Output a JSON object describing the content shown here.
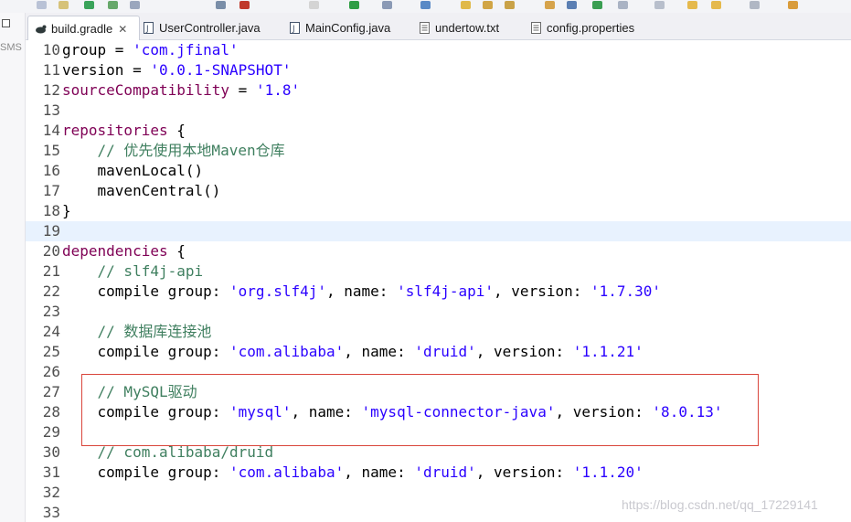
{
  "sidebar": {
    "label": "SMS"
  },
  "tabs": [
    {
      "label": "build.gradle",
      "icon": "gradle-file-icon",
      "active": true,
      "closable": true
    },
    {
      "label": "UserController.java",
      "icon": "java-file-icon",
      "active": false
    },
    {
      "label": "MainConfig.java",
      "icon": "java-file-icon",
      "active": false
    },
    {
      "label": "undertow.txt",
      "icon": "text-file-icon",
      "active": false
    },
    {
      "label": "config.properties",
      "icon": "properties-file-icon",
      "active": false
    }
  ],
  "tab_close_glyph": "✕",
  "editor": {
    "current_line": 19,
    "lines": [
      {
        "n": "10",
        "segs": [
          {
            "t": "group = ",
            "c": "pl"
          },
          {
            "t": "'com.jfinal'",
            "c": "str"
          }
        ]
      },
      {
        "n": "11",
        "segs": [
          {
            "t": "version = ",
            "c": "pl"
          },
          {
            "t": "'0.0.1-SNAPSHOT'",
            "c": "str"
          }
        ]
      },
      {
        "n": "12",
        "segs": [
          {
            "t": "sourceCompatibility",
            "c": "kw"
          },
          {
            "t": " = ",
            "c": "pl"
          },
          {
            "t": "'1.8'",
            "c": "str"
          }
        ]
      },
      {
        "n": "13",
        "segs": []
      },
      {
        "n": "14",
        "segs": [
          {
            "t": "repositories",
            "c": "kw"
          },
          {
            "t": " {",
            "c": "pl"
          }
        ]
      },
      {
        "n": "15",
        "segs": [
          {
            "t": "    ",
            "c": "pl"
          },
          {
            "t": "// 优先使用本地Maven仓库",
            "c": "cm"
          }
        ]
      },
      {
        "n": "16",
        "segs": [
          {
            "t": "    mavenLocal()",
            "c": "pl"
          }
        ]
      },
      {
        "n": "17",
        "segs": [
          {
            "t": "    mavenCentral()",
            "c": "pl"
          }
        ]
      },
      {
        "n": "18",
        "segs": [
          {
            "t": "}",
            "c": "pl"
          }
        ]
      },
      {
        "n": "19",
        "segs": []
      },
      {
        "n": "20",
        "segs": [
          {
            "t": "dependencies",
            "c": "kw"
          },
          {
            "t": " {",
            "c": "pl"
          }
        ]
      },
      {
        "n": "21",
        "segs": [
          {
            "t": "    ",
            "c": "pl"
          },
          {
            "t": "// slf4j-api",
            "c": "cm"
          }
        ]
      },
      {
        "n": "22",
        "segs": [
          {
            "t": "    compile group: ",
            "c": "pl"
          },
          {
            "t": "'org.slf4j'",
            "c": "str"
          },
          {
            "t": ", name: ",
            "c": "pl"
          },
          {
            "t": "'slf4j-api'",
            "c": "str"
          },
          {
            "t": ", version: ",
            "c": "pl"
          },
          {
            "t": "'1.7.30'",
            "c": "str"
          }
        ]
      },
      {
        "n": "23",
        "segs": []
      },
      {
        "n": "24",
        "segs": [
          {
            "t": "    ",
            "c": "pl"
          },
          {
            "t": "// 数据库连接池",
            "c": "cm"
          }
        ]
      },
      {
        "n": "25",
        "segs": [
          {
            "t": "    compile group: ",
            "c": "pl"
          },
          {
            "t": "'com.alibaba'",
            "c": "str"
          },
          {
            "t": ", name: ",
            "c": "pl"
          },
          {
            "t": "'druid'",
            "c": "str"
          },
          {
            "t": ", version: ",
            "c": "pl"
          },
          {
            "t": "'1.1.21'",
            "c": "str"
          }
        ]
      },
      {
        "n": "26",
        "segs": []
      },
      {
        "n": "27",
        "segs": [
          {
            "t": "    ",
            "c": "pl"
          },
          {
            "t": "// MySQL驱动",
            "c": "cm"
          }
        ]
      },
      {
        "n": "28",
        "segs": [
          {
            "t": "    compile group: ",
            "c": "pl"
          },
          {
            "t": "'mysql'",
            "c": "str"
          },
          {
            "t": ", name: ",
            "c": "pl"
          },
          {
            "t": "'mysql-connector-java'",
            "c": "str"
          },
          {
            "t": ", version: ",
            "c": "pl"
          },
          {
            "t": "'8.0.13'",
            "c": "str"
          }
        ]
      },
      {
        "n": "29",
        "segs": []
      },
      {
        "n": "30",
        "segs": [
          {
            "t": "    ",
            "c": "pl"
          },
          {
            "t": "// com.alibaba/druid",
            "c": "cm"
          }
        ]
      },
      {
        "n": "31",
        "segs": [
          {
            "t": "    compile group: ",
            "c": "pl"
          },
          {
            "t": "'com.alibaba'",
            "c": "str"
          },
          {
            "t": ", name: ",
            "c": "pl"
          },
          {
            "t": "'druid'",
            "c": "str"
          },
          {
            "t": ", version: ",
            "c": "pl"
          },
          {
            "t": "'1.1.20'",
            "c": "str"
          }
        ]
      },
      {
        "n": "32",
        "segs": []
      },
      {
        "n": "33",
        "segs": []
      }
    ]
  },
  "colors": {
    "keyword": "#7f0055",
    "string": "#2a00ff",
    "comment": "#3f7f5f",
    "current_line_bg": "#e8f2fe",
    "highlight_box": "#d9453b"
  },
  "watermark": "https://blog.csdn.net/qq_17229141"
}
